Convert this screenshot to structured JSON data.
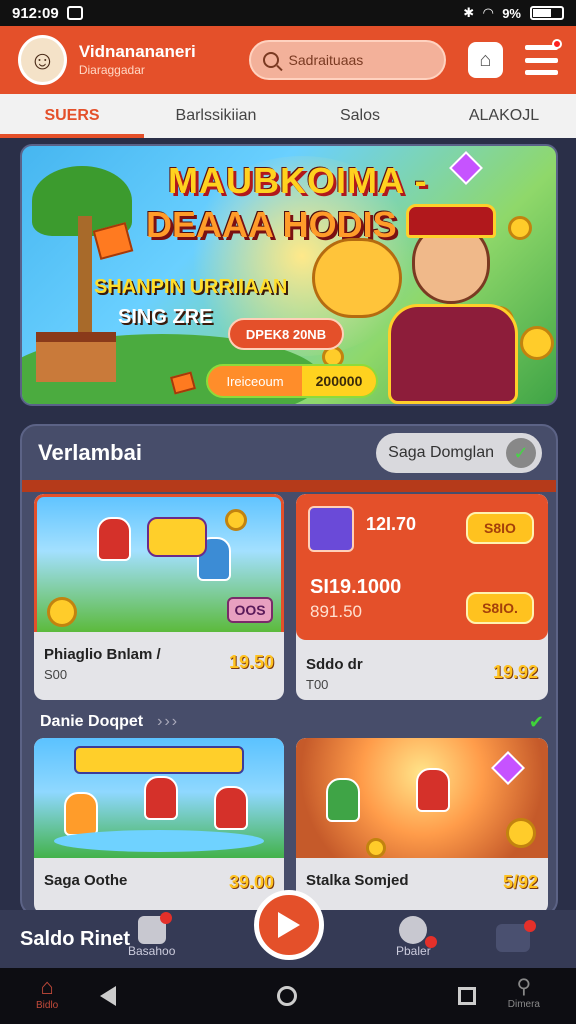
{
  "status": {
    "time": "912:09",
    "battery": "9%"
  },
  "header": {
    "user_name": "Vidnanananeri",
    "user_sub": "Diaraggadar",
    "search_placeholder": "Sadraituaas"
  },
  "tabs": [
    {
      "label": "SUERS",
      "active": true
    },
    {
      "label": "Barlssikiian",
      "active": false
    },
    {
      "label": "Salos",
      "active": false
    },
    {
      "label": "ALAKOJL",
      "active": false
    }
  ],
  "banner": {
    "title_line1": "MAUBKOIMA -",
    "title_line2": "DEAAA HODIS",
    "subtitle1": "SHANPIN URRIIAAN",
    "subtitle2": "SING ZRE",
    "button1": "DPEK8 20NB",
    "button2_left": "Ireiceoum",
    "button2_right": "200000"
  },
  "panel": {
    "title": "Verlambai",
    "toggle_label": "Saga Domglan",
    "cards_top": [
      {
        "name": "Phiaglio Bnlam /",
        "sub": "S00",
        "price": "19.50",
        "img_label": "OOS"
      },
      {
        "value1": "12I.70",
        "value2": "SI19.1000",
        "value3": "891.50",
        "btn1": "S8IO",
        "btn2": "S8IO.",
        "name": "Sddo dr",
        "sub": "T00",
        "price": "19.92"
      }
    ],
    "section2_title": "Danie Doqpet",
    "section2_arrows": "›››",
    "cards_bottom": [
      {
        "name": "Saga Oothe",
        "price": "39.00"
      },
      {
        "name": "Stalka Somjed",
        "price": "5/92"
      }
    ]
  },
  "appbar": {
    "label": "Saldo Rinet",
    "nav_left": "Basahoo",
    "nav_right": "Pbaler"
  },
  "sysnav": {
    "left_label": "Bidlo",
    "right_label": "Dimera"
  },
  "colors": {
    "accent": "#e4502a",
    "gold": "#ffc21f",
    "panel": "#474d6a"
  }
}
